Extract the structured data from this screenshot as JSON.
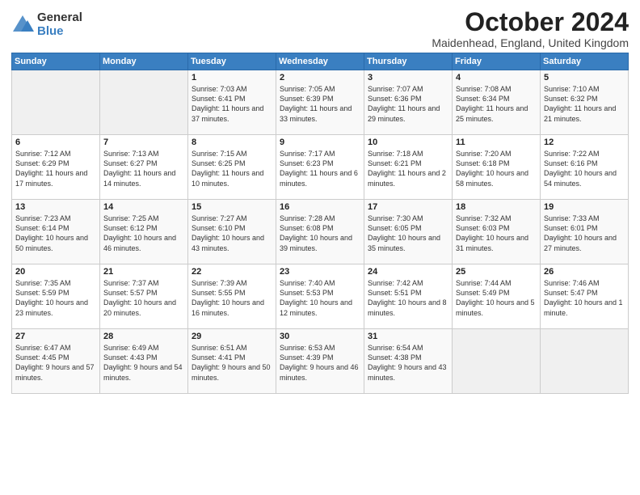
{
  "logo": {
    "general": "General",
    "blue": "Blue"
  },
  "title": "October 2024",
  "location": "Maidenhead, England, United Kingdom",
  "days_header": [
    "Sunday",
    "Monday",
    "Tuesday",
    "Wednesday",
    "Thursday",
    "Friday",
    "Saturday"
  ],
  "weeks": [
    [
      {
        "day": "",
        "content": ""
      },
      {
        "day": "",
        "content": ""
      },
      {
        "day": "1",
        "content": "Sunrise: 7:03 AM\nSunset: 6:41 PM\nDaylight: 11 hours and 37 minutes."
      },
      {
        "day": "2",
        "content": "Sunrise: 7:05 AM\nSunset: 6:39 PM\nDaylight: 11 hours and 33 minutes."
      },
      {
        "day": "3",
        "content": "Sunrise: 7:07 AM\nSunset: 6:36 PM\nDaylight: 11 hours and 29 minutes."
      },
      {
        "day": "4",
        "content": "Sunrise: 7:08 AM\nSunset: 6:34 PM\nDaylight: 11 hours and 25 minutes."
      },
      {
        "day": "5",
        "content": "Sunrise: 7:10 AM\nSunset: 6:32 PM\nDaylight: 11 hours and 21 minutes."
      }
    ],
    [
      {
        "day": "6",
        "content": "Sunrise: 7:12 AM\nSunset: 6:29 PM\nDaylight: 11 hours and 17 minutes."
      },
      {
        "day": "7",
        "content": "Sunrise: 7:13 AM\nSunset: 6:27 PM\nDaylight: 11 hours and 14 minutes."
      },
      {
        "day": "8",
        "content": "Sunrise: 7:15 AM\nSunset: 6:25 PM\nDaylight: 11 hours and 10 minutes."
      },
      {
        "day": "9",
        "content": "Sunrise: 7:17 AM\nSunset: 6:23 PM\nDaylight: 11 hours and 6 minutes."
      },
      {
        "day": "10",
        "content": "Sunrise: 7:18 AM\nSunset: 6:21 PM\nDaylight: 11 hours and 2 minutes."
      },
      {
        "day": "11",
        "content": "Sunrise: 7:20 AM\nSunset: 6:18 PM\nDaylight: 10 hours and 58 minutes."
      },
      {
        "day": "12",
        "content": "Sunrise: 7:22 AM\nSunset: 6:16 PM\nDaylight: 10 hours and 54 minutes."
      }
    ],
    [
      {
        "day": "13",
        "content": "Sunrise: 7:23 AM\nSunset: 6:14 PM\nDaylight: 10 hours and 50 minutes."
      },
      {
        "day": "14",
        "content": "Sunrise: 7:25 AM\nSunset: 6:12 PM\nDaylight: 10 hours and 46 minutes."
      },
      {
        "day": "15",
        "content": "Sunrise: 7:27 AM\nSunset: 6:10 PM\nDaylight: 10 hours and 43 minutes."
      },
      {
        "day": "16",
        "content": "Sunrise: 7:28 AM\nSunset: 6:08 PM\nDaylight: 10 hours and 39 minutes."
      },
      {
        "day": "17",
        "content": "Sunrise: 7:30 AM\nSunset: 6:05 PM\nDaylight: 10 hours and 35 minutes."
      },
      {
        "day": "18",
        "content": "Sunrise: 7:32 AM\nSunset: 6:03 PM\nDaylight: 10 hours and 31 minutes."
      },
      {
        "day": "19",
        "content": "Sunrise: 7:33 AM\nSunset: 6:01 PM\nDaylight: 10 hours and 27 minutes."
      }
    ],
    [
      {
        "day": "20",
        "content": "Sunrise: 7:35 AM\nSunset: 5:59 PM\nDaylight: 10 hours and 23 minutes."
      },
      {
        "day": "21",
        "content": "Sunrise: 7:37 AM\nSunset: 5:57 PM\nDaylight: 10 hours and 20 minutes."
      },
      {
        "day": "22",
        "content": "Sunrise: 7:39 AM\nSunset: 5:55 PM\nDaylight: 10 hours and 16 minutes."
      },
      {
        "day": "23",
        "content": "Sunrise: 7:40 AM\nSunset: 5:53 PM\nDaylight: 10 hours and 12 minutes."
      },
      {
        "day": "24",
        "content": "Sunrise: 7:42 AM\nSunset: 5:51 PM\nDaylight: 10 hours and 8 minutes."
      },
      {
        "day": "25",
        "content": "Sunrise: 7:44 AM\nSunset: 5:49 PM\nDaylight: 10 hours and 5 minutes."
      },
      {
        "day": "26",
        "content": "Sunrise: 7:46 AM\nSunset: 5:47 PM\nDaylight: 10 hours and 1 minute."
      }
    ],
    [
      {
        "day": "27",
        "content": "Sunrise: 6:47 AM\nSunset: 4:45 PM\nDaylight: 9 hours and 57 minutes."
      },
      {
        "day": "28",
        "content": "Sunrise: 6:49 AM\nSunset: 4:43 PM\nDaylight: 9 hours and 54 minutes."
      },
      {
        "day": "29",
        "content": "Sunrise: 6:51 AM\nSunset: 4:41 PM\nDaylight: 9 hours and 50 minutes."
      },
      {
        "day": "30",
        "content": "Sunrise: 6:53 AM\nSunset: 4:39 PM\nDaylight: 9 hours and 46 minutes."
      },
      {
        "day": "31",
        "content": "Sunrise: 6:54 AM\nSunset: 4:38 PM\nDaylight: 9 hours and 43 minutes."
      },
      {
        "day": "",
        "content": ""
      },
      {
        "day": "",
        "content": ""
      }
    ]
  ]
}
